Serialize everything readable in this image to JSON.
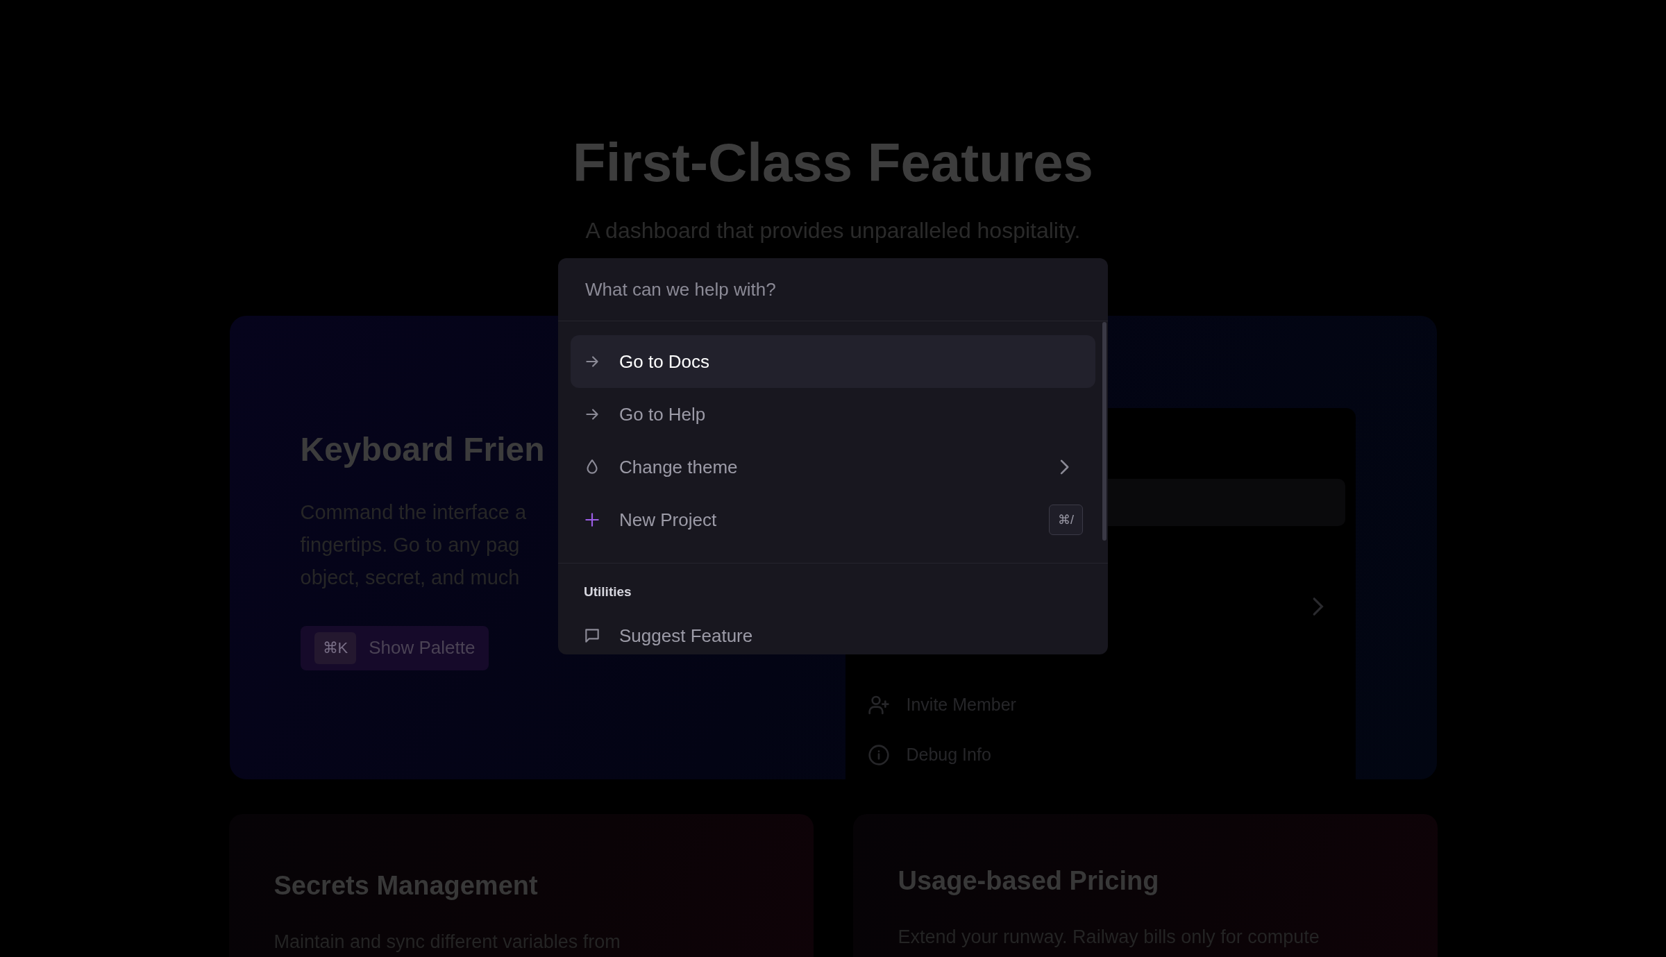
{
  "header": {
    "title": "First-Class Features",
    "subtitle": "A dashboard that provides unparalleled hospitality."
  },
  "feature_card": {
    "title": "Keyboard Frien",
    "description_lines": [
      "Command the interface a",
      "fingertips. Go to any pag",
      "object, secret, and much"
    ],
    "button": {
      "shortcut": "⌘K",
      "label": "Show Palette"
    },
    "preview": {
      "items": [
        {
          "kind": "invite",
          "label": "Invite Member"
        },
        {
          "kind": "info",
          "label": "Debug Info"
        }
      ]
    }
  },
  "cards": [
    {
      "title": "Secrets Management",
      "description": "Maintain and sync different variables from"
    },
    {
      "title": "Usage-based Pricing",
      "description": "Extend your runway. Railway bills only for compute"
    }
  ],
  "command_palette": {
    "placeholder": "What can we help with?",
    "items": [
      {
        "kind": "arrow",
        "label": "Go to Docs",
        "selected": true
      },
      {
        "kind": "arrow",
        "label": "Go to Help",
        "selected": false
      },
      {
        "kind": "drop",
        "label": "Change theme",
        "selected": false,
        "submenu": true
      },
      {
        "kind": "plus",
        "label": "New Project",
        "selected": false,
        "shortcut": "⌘/"
      }
    ],
    "groups": [
      {
        "heading": "Utilities",
        "items": [
          {
            "kind": "chat",
            "label": "Suggest Feature",
            "selected": false
          }
        ]
      }
    ]
  }
}
